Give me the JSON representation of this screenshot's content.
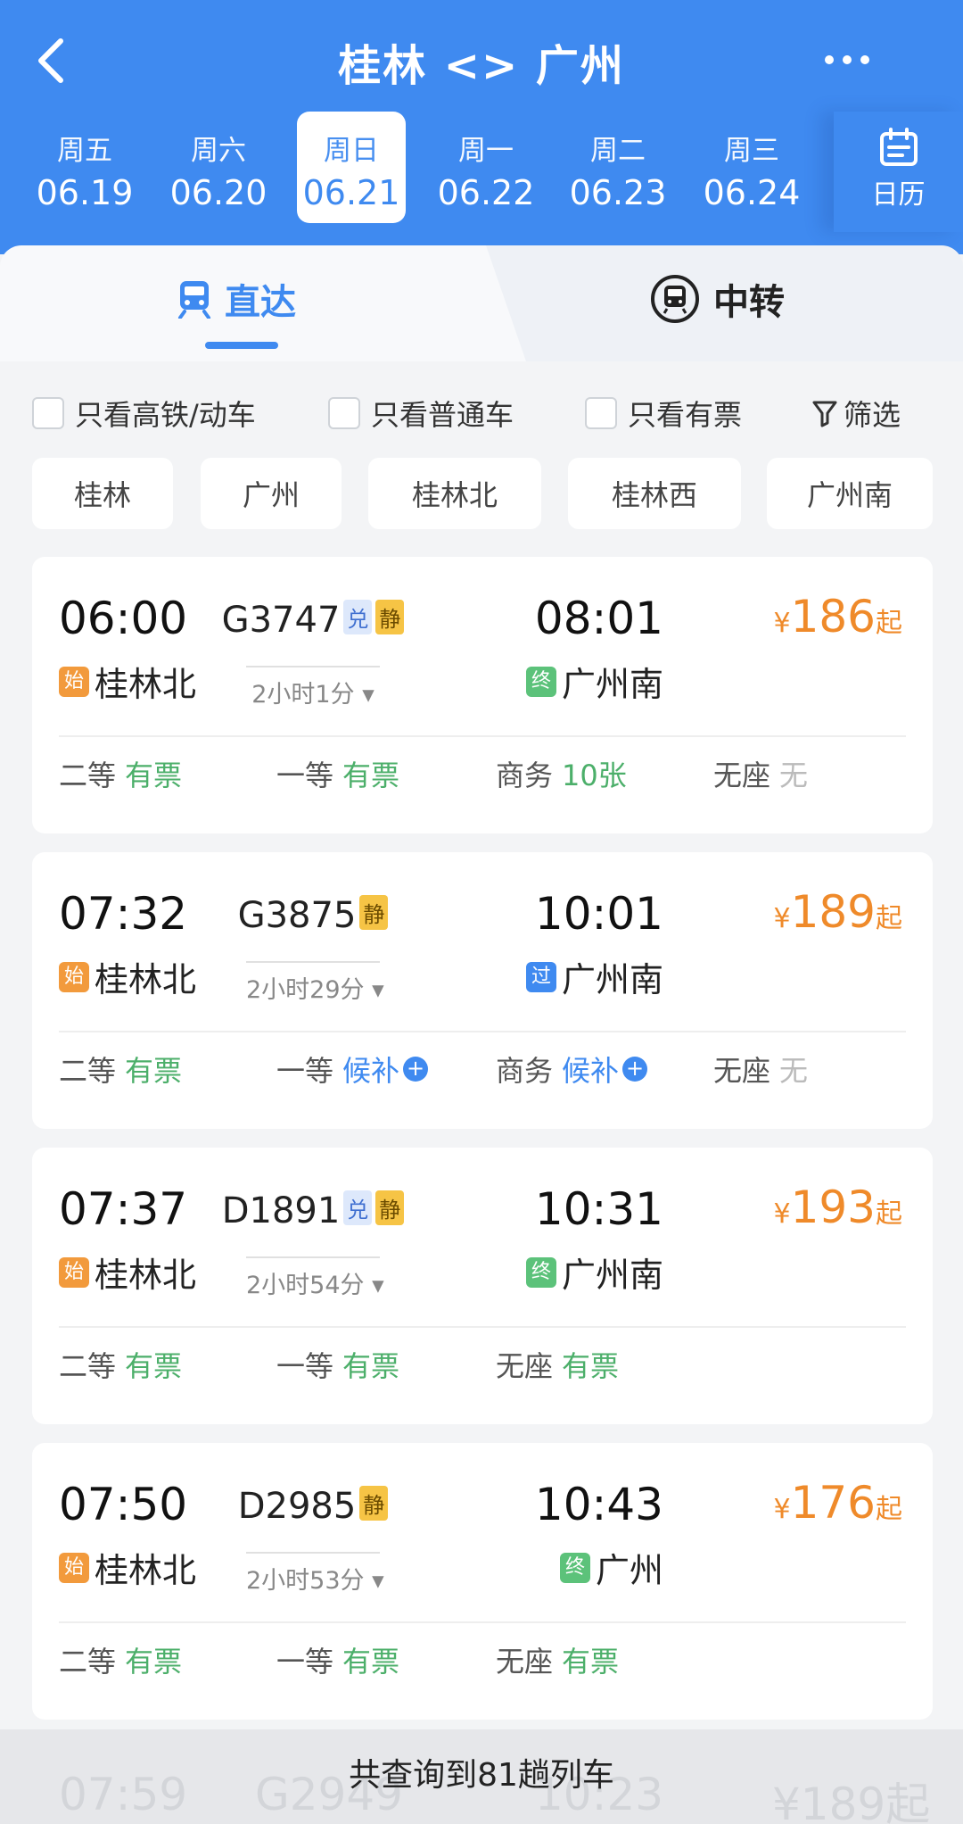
{
  "header": {
    "title": "桂林 <> 广州",
    "dates": [
      {
        "weekday": "周五",
        "date": "06.19"
      },
      {
        "weekday": "周六",
        "date": "06.20"
      },
      {
        "weekday": "周日",
        "date": "06.21"
      },
      {
        "weekday": "周一",
        "date": "06.22"
      },
      {
        "weekday": "周二",
        "date": "06.23"
      },
      {
        "weekday": "周三",
        "date": "06.24"
      }
    ],
    "calendar_label": "日历"
  },
  "tabs": {
    "direct": "直达",
    "transfer": "中转"
  },
  "filters": {
    "gaotie": "只看高铁/动车",
    "putong": "只看普通车",
    "youpiao": "只看有票",
    "shaixuan": "筛选"
  },
  "stations": [
    "桂林",
    "广州",
    "桂林北",
    "桂林西",
    "广州南"
  ],
  "trains": [
    {
      "depart_time": "06:00",
      "train_no": "G3747",
      "badges": [
        "兑",
        "静"
      ],
      "duration": "2小时1分",
      "arrive_time": "08:01",
      "depart_tag": "始",
      "depart_station": "桂林北",
      "arrive_tag": "终",
      "arrive_station": "广州南",
      "price_symbol": "¥",
      "price": "186",
      "price_suffix": "起",
      "seats": [
        {
          "name": "二等",
          "status": "有票"
        },
        {
          "name": "一等",
          "status": "有票"
        },
        {
          "name": "商务",
          "status": "10张"
        },
        {
          "name": "无座",
          "status": "无"
        }
      ]
    },
    {
      "depart_time": "07:32",
      "train_no": "G3875",
      "badges": [
        "静"
      ],
      "duration": "2小时29分",
      "arrive_time": "10:01",
      "depart_tag": "始",
      "depart_station": "桂林北",
      "arrive_tag": "过",
      "arrive_station": "广州南",
      "price_symbol": "¥",
      "price": "189",
      "price_suffix": "起",
      "seats": [
        {
          "name": "二等",
          "status": "有票"
        },
        {
          "name": "一等",
          "status": "候补"
        },
        {
          "name": "商务",
          "status": "候补"
        },
        {
          "name": "无座",
          "status": "无"
        }
      ]
    },
    {
      "depart_time": "07:37",
      "train_no": "D1891",
      "badges": [
        "兑",
        "静"
      ],
      "duration": "2小时54分",
      "arrive_time": "10:31",
      "depart_tag": "始",
      "depart_station": "桂林北",
      "arrive_tag": "终",
      "arrive_station": "广州南",
      "price_symbol": "¥",
      "price": "193",
      "price_suffix": "起",
      "seats": [
        {
          "name": "二等",
          "status": "有票"
        },
        {
          "name": "一等",
          "status": "有票"
        },
        {
          "name": "无座",
          "status": "有票"
        }
      ]
    },
    {
      "depart_time": "07:50",
      "train_no": "D2985",
      "badges": [
        "静"
      ],
      "duration": "2小时53分",
      "arrive_time": "10:43",
      "depart_tag": "始",
      "depart_station": "桂林北",
      "arrive_tag": "终",
      "arrive_station": "广州",
      "price_symbol": "¥",
      "price": "176",
      "price_suffix": "起",
      "seats": [
        {
          "name": "二等",
          "status": "有票"
        },
        {
          "name": "一等",
          "status": "有票"
        },
        {
          "name": "无座",
          "status": "有票"
        }
      ]
    }
  ],
  "partial_row": {
    "depart_time": "07:59",
    "train_no": "G2949",
    "arrive_time": "10:23",
    "price": "¥189起"
  },
  "summary": "共查询到81趟列车",
  "colors": {
    "brand_blue": "#3f8af0",
    "price_orange": "#ef8a2a",
    "available_green": "#4caf6a"
  }
}
